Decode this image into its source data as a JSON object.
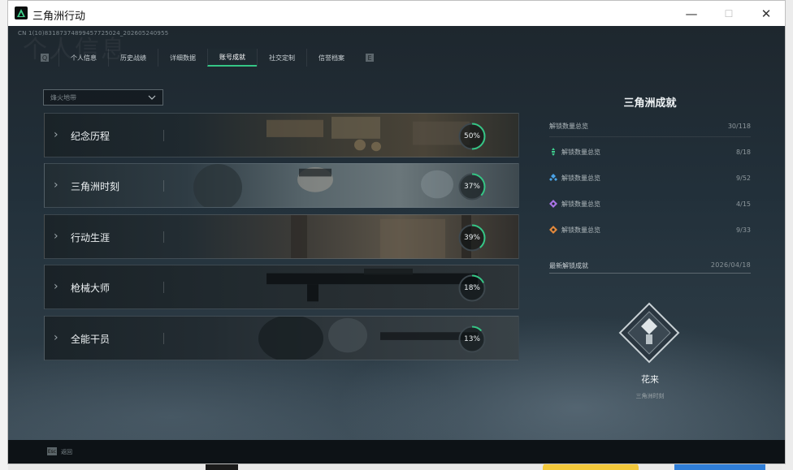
{
  "window": {
    "title": "三角洲行动"
  },
  "window_controls": {
    "minimize": "—",
    "maximize": "☐",
    "close": "✕"
  },
  "header": {
    "uid": "CN 1(10)83187374899457725024_202605240955",
    "watermark": "个人信息"
  },
  "tabs": [
    {
      "label": "个人信息",
      "active": false
    },
    {
      "label": "历史战绩",
      "active": false
    },
    {
      "label": "详细数据",
      "active": false
    },
    {
      "label": "账号成就",
      "active": true
    },
    {
      "label": "社交定制",
      "active": false
    },
    {
      "label": "信誉档案",
      "active": false
    }
  ],
  "tab_nav": {
    "prev_key": "Q",
    "next_key": "E"
  },
  "filter": {
    "value": "烽火地带"
  },
  "categories": [
    {
      "name": "纪念历程",
      "percent": 50,
      "percent_label": "50%"
    },
    {
      "name": "三角洲时刻",
      "percent": 37,
      "percent_label": "37%"
    },
    {
      "name": "行动生涯",
      "percent": 39,
      "percent_label": "39%"
    },
    {
      "name": "枪械大师",
      "percent": 18,
      "percent_label": "18%"
    },
    {
      "name": "全能干员",
      "percent": 13,
      "percent_label": "13%"
    }
  ],
  "panel": {
    "title": "三角洲成就",
    "total": {
      "label": "解锁数量总览",
      "value": "30/118"
    },
    "rows": [
      {
        "label": "解锁数量总览",
        "value": "8/18",
        "icon": "green-rank-icon",
        "color": "#3fcf8e"
      },
      {
        "label": "解锁数量总览",
        "value": "9/52",
        "icon": "blue-rank-icon",
        "color": "#4aa3e8"
      },
      {
        "label": "解锁数量总览",
        "value": "4/15",
        "icon": "purple-rank-icon",
        "color": "#a974e6"
      },
      {
        "label": "解锁数量总览",
        "value": "9/33",
        "icon": "orange-rank-icon",
        "color": "#e58a3c"
      }
    ],
    "latest": {
      "label": "最新解锁成就",
      "date": "2026/04/18"
    },
    "medal": {
      "name": "花来",
      "category": "三角洲时刻"
    }
  },
  "footer": {
    "key": "Esc",
    "label": "返回"
  },
  "colors": {
    "accent": "#35c685",
    "ring_track": "#3d474d"
  }
}
